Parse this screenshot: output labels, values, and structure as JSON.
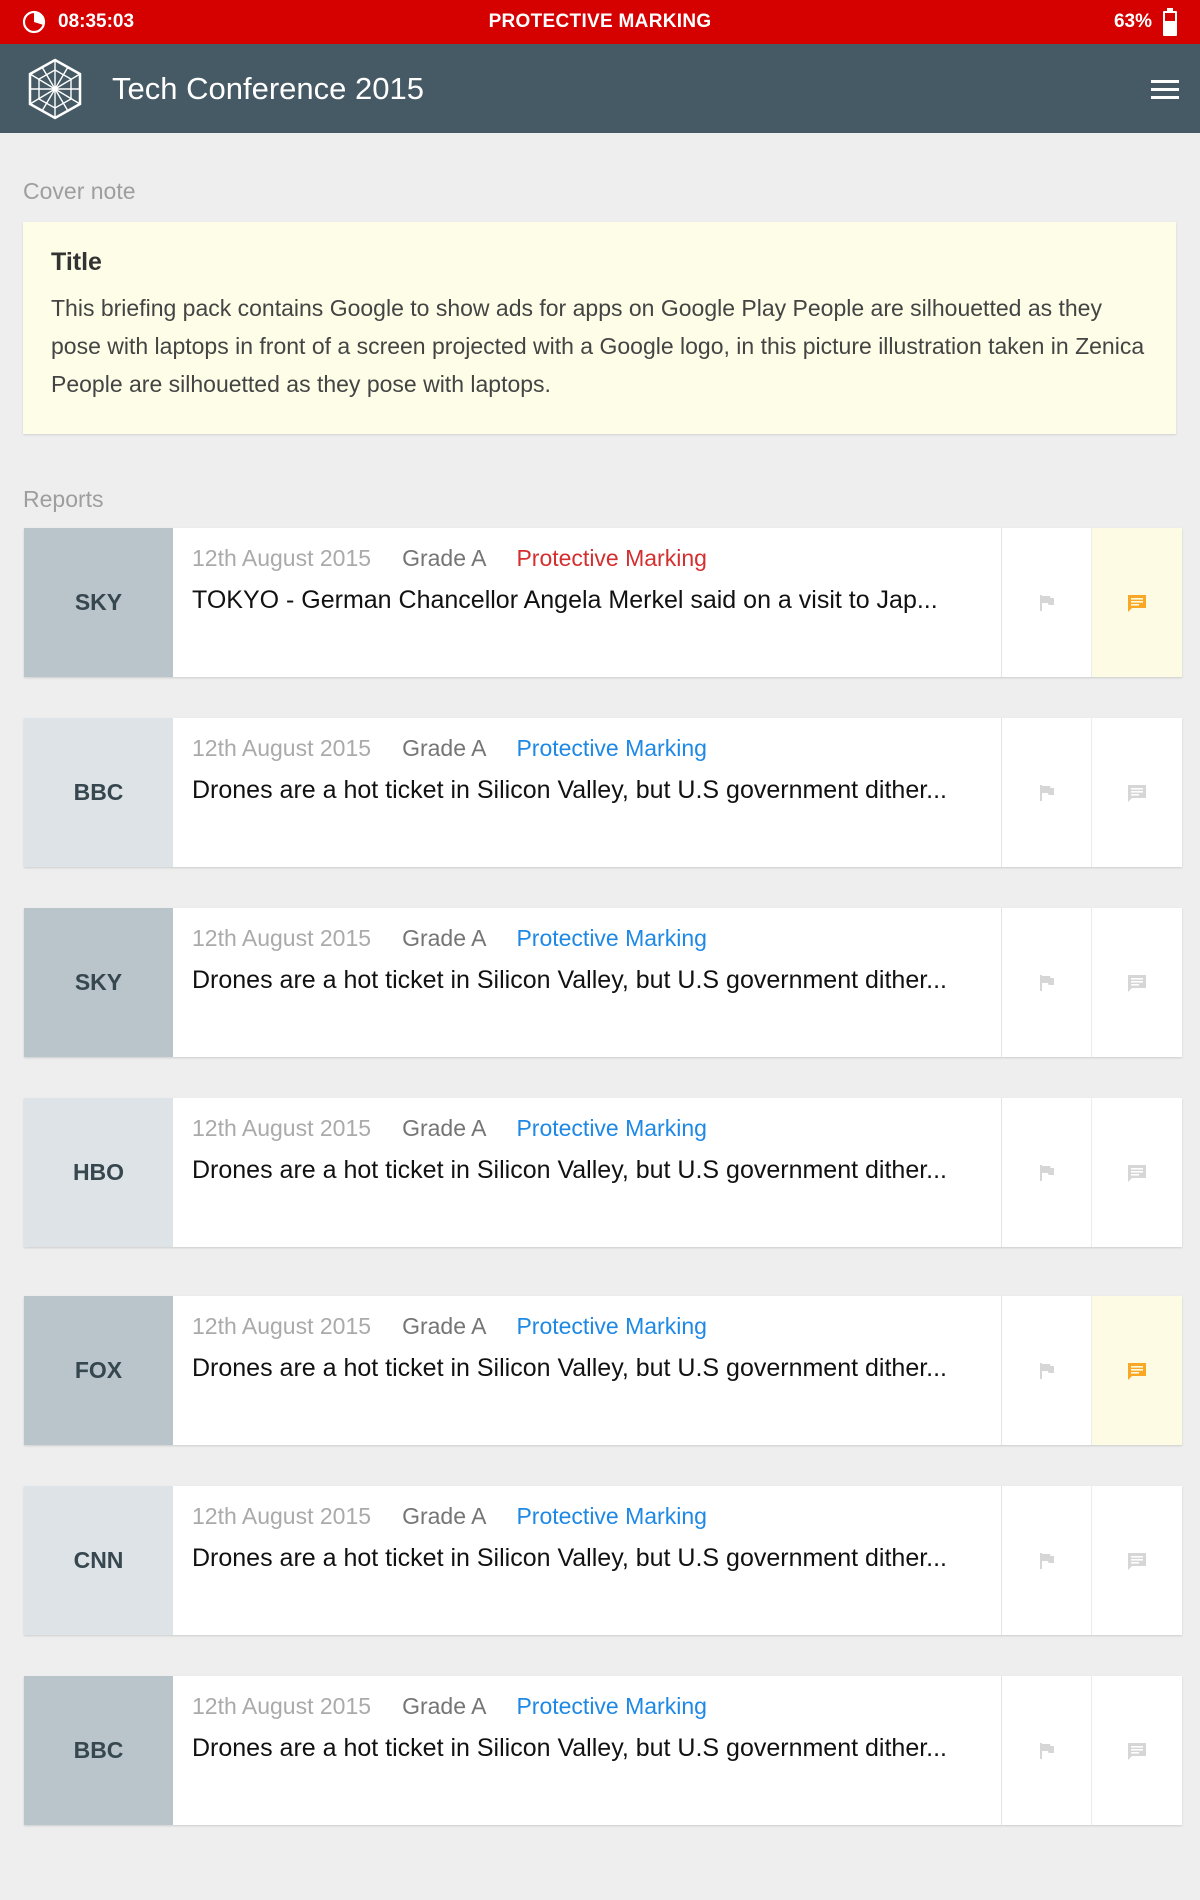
{
  "status_bar": {
    "time": "08:35:03",
    "marking": "PROTECTIVE MARKING",
    "battery": "63%"
  },
  "app_bar": {
    "title": "Tech Conference 2015"
  },
  "cover": {
    "section_label": "Cover note",
    "title": "Title",
    "body": "This briefing pack contains Google to show ads for apps on Google Play People are silhouetted as they pose with laptops in front of a screen projected with a Google logo, in this picture illustration taken in Zenica People are silhouetted as they pose with laptops."
  },
  "reports_label": "Reports",
  "reports": [
    {
      "source": "SKY",
      "date": "12th August 2015",
      "grade": "Grade A",
      "marking": "Protective Marking",
      "marking_color": "#d32f2f",
      "headline": "TOKYO - German Chancellor Angela Merkel said on a visit to Jap...",
      "comment_active": true
    },
    {
      "source": "BBC",
      "date": "12th August 2015",
      "grade": "Grade A",
      "marking": "Protective Marking",
      "marking_color": "#1e88e5",
      "headline": "Drones are a hot ticket in Silicon Valley, but U.S government dither...",
      "comment_active": false
    },
    {
      "source": "SKY",
      "date": "12th August 2015",
      "grade": "Grade A",
      "marking": "Protective Marking",
      "marking_color": "#1e88e5",
      "headline": "Drones are a hot ticket in Silicon Valley, but U.S government dither...",
      "comment_active": false
    },
    {
      "source": "HBO",
      "date": "12th August 2015",
      "grade": "Grade A",
      "marking": "Protective Marking",
      "marking_color": "#1e88e5",
      "headline": "Drones are a hot ticket in Silicon Valley, but U.S government dither...",
      "comment_active": false
    },
    {
      "source": "FOX",
      "date": "12th August 2015",
      "grade": "Grade A",
      "marking": "Protective Marking",
      "marking_color": "#1e88e5",
      "headline": "Drones are a hot ticket in Silicon Valley, but U.S government dither...",
      "comment_active": true
    },
    {
      "source": "CNN",
      "date": "12th August 2015",
      "grade": "Grade A",
      "marking": "Protective Marking",
      "marking_color": "#1e88e5",
      "headline": "Drones are a hot ticket in Silicon Valley, but U.S government dither...",
      "comment_active": false
    },
    {
      "source": "BBC",
      "date": "12th August 2015",
      "grade": "Grade A",
      "marking": "Protective Marking",
      "marking_color": "#1e88e5",
      "headline": "Drones are a hot ticket in Silicon Valley, but U.S government dither...",
      "comment_active": false
    }
  ],
  "icons": {
    "status_clock": "clock-icon",
    "battery": "battery-icon",
    "logo": "app-logo-icon",
    "menu": "menu-icon",
    "flag": "flag-icon",
    "comment": "comment-icon"
  },
  "colors": {
    "status_bar": "#d50000",
    "app_bar": "#455a64",
    "cover_bg": "#fefde7",
    "comment_active": "#f9a825",
    "comment_inactive": "#d6d6d6",
    "flag": "#d6d6d6"
  }
}
